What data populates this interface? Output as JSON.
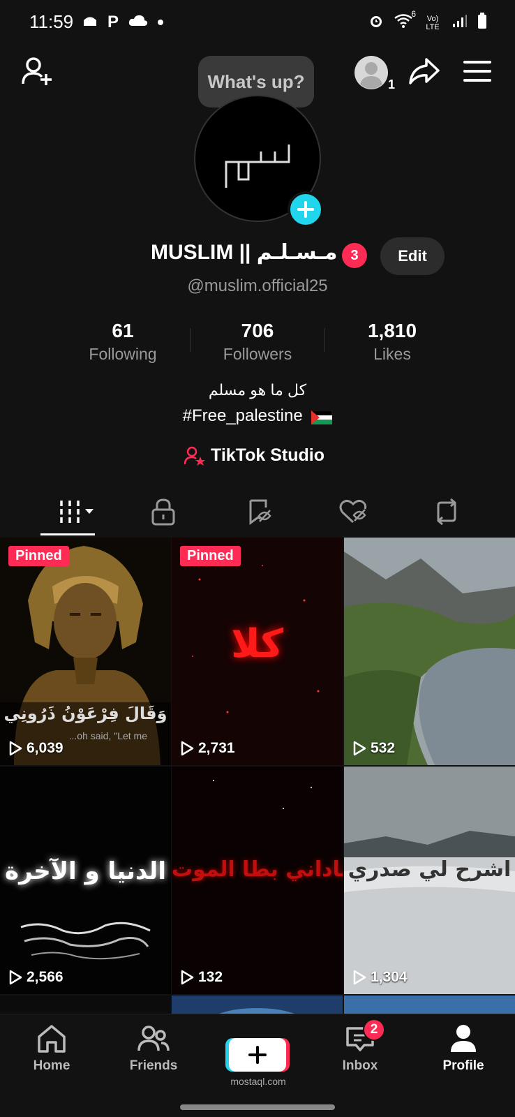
{
  "status_bar": {
    "time": "11:59",
    "net_label": "Vo) LTE",
    "wifi_label": "6"
  },
  "header": {
    "avatar_badge": "1",
    "bubble_text": "What's up?"
  },
  "profile": {
    "avatar_text": "مسلم",
    "name": "MUSLIM || مـسـلـم",
    "badge_count": "3",
    "edit_label": "Edit",
    "handle": "@muslim.official25"
  },
  "stats": [
    {
      "value": "61",
      "label": "Following"
    },
    {
      "value": "706",
      "label": "Followers"
    },
    {
      "value": "1,810",
      "label": "Likes"
    }
  ],
  "bio": {
    "line1": "كل ما هو مسلم",
    "line2": "#Free_palestine"
  },
  "studio_label": "TikTok Studio",
  "videos": [
    {
      "pinned": "Pinned",
      "views": "6,039",
      "caption": "وَقَالَ فِرْعَوْنُ ذَرُونِي",
      "subcaption": "...oh said, \"Let me"
    },
    {
      "pinned": "Pinned",
      "views": "2,731",
      "caption": "كلا"
    },
    {
      "views": "532"
    },
    {
      "views": "2,566",
      "caption": "الدنيا و الآخرة"
    },
    {
      "views": "132",
      "caption": "ناداني بطا الموت"
    },
    {
      "views": "1,304",
      "caption": "اشرح لي صدري"
    }
  ],
  "nav": {
    "home": "Home",
    "friends": "Friends",
    "inbox": "Inbox",
    "inbox_badge": "2",
    "profile": "Profile",
    "watermark": "mostaql.com"
  }
}
